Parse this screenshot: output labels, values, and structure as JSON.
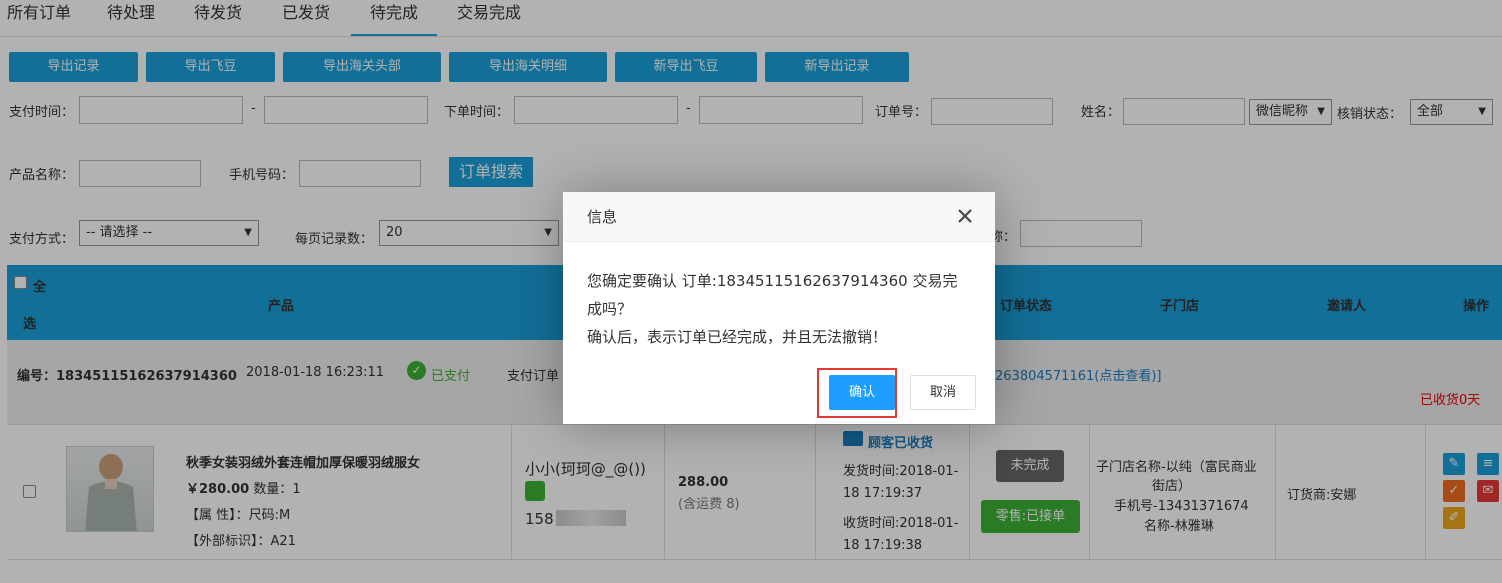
{
  "tabs": [
    {
      "label": "所有订单"
    },
    {
      "label": "待处理"
    },
    {
      "label": "待发货"
    },
    {
      "label": "已发货"
    },
    {
      "label": "待完成"
    },
    {
      "label": "交易完成"
    }
  ],
  "toolbar": [
    {
      "label": "导出记录"
    },
    {
      "label": "导出飞豆"
    },
    {
      "label": "导出海关头部"
    },
    {
      "label": "导出海关明细"
    },
    {
      "label": "新导出飞豆"
    },
    {
      "label": "新导出记录"
    }
  ],
  "filters": {
    "pay_time_label": "支付时间：",
    "dash": "-",
    "order_time_label": "下单时间：",
    "order_no_label": "订单号：",
    "name_label": "姓名：",
    "wechat_select": "微信昵称",
    "verify_label": "核销状态：",
    "verify_select": "全部",
    "product_label": "产品名称：",
    "phone_label": "手机号码：",
    "search_button": "订单搜索",
    "pay_method_label": "支付方式：",
    "pay_method_select": "-- 请选择 --",
    "page_size_label": "每页记录数：",
    "page_size_select": "20",
    "partial_label": "称："
  },
  "table_header": {
    "select_all_1": "全",
    "select_all_2": "选",
    "product": "产品",
    "order_status": "订单状态",
    "substore": "子门店",
    "inviter": "邀请人",
    "action": "操作"
  },
  "order": {
    "number_label": "编号：",
    "number": "18345115162637914360",
    "datetime": "2018-01-18 16:23:11",
    "paid": "已支付",
    "pay_order_partial": "支付订单",
    "trans_link": "263804571161(点击查看)]",
    "received_days": "已收货0天",
    "product_name": "秋季女装羽绒外套连帽加厚保暖羽绒服女",
    "price": "￥280.00",
    "qty": "数量：1",
    "attr": "【属 性】：尺码:M",
    "ext_id": "【外部标识】：A21",
    "buyer": "小小(珂珂@_@())",
    "phone_partial": "158",
    "amount": "288.00",
    "shipping": "(含运费 8)",
    "customer_received": "顾客已收货",
    "ship_time_1": "发货时间:2018-01-",
    "ship_time_2": "18 17:19:37",
    "recv_time_1": "收货时间:2018-01-",
    "recv_time_2": "18 17:19:38",
    "status_incomplete": "未完成",
    "status_retail": "零售:已接单",
    "store_line1": "子门店名称-以纯（富民商业",
    "store_line2": "街店）",
    "store_line3": "手机号-13431371674",
    "store_line4": "名称-林雅琳",
    "inviter": "订货商:安娜"
  },
  "dialog": {
    "title": "信息",
    "line1": "您确定要确认 订单:18345115162637914360 交易完",
    "line2": "成吗？",
    "line3": "确认后，表示订单已经完成，并且无法撤销！",
    "confirm": "确认",
    "cancel": "取消"
  },
  "colors": {
    "primary": "#1a9fd8",
    "success": "#3cb034",
    "danger": "#e53935",
    "dialog_btn": "#1e9fff"
  }
}
